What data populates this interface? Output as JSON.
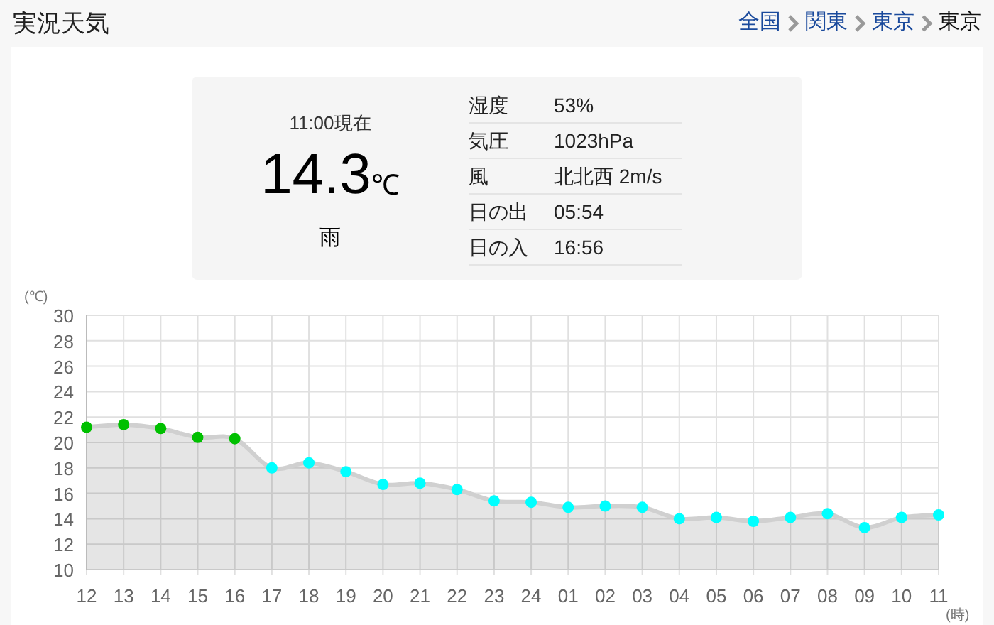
{
  "header": {
    "title": "実況天気"
  },
  "breadcrumb": [
    {
      "label": "全国",
      "link": true
    },
    {
      "label": "関東",
      "link": true
    },
    {
      "label": "東京",
      "link": true
    },
    {
      "label": "東京",
      "link": false
    }
  ],
  "current": {
    "time": "11:00現在",
    "temperature": "14.3",
    "unit": "℃",
    "weather": "雨"
  },
  "details": [
    {
      "label": "湿度",
      "value": "53%"
    },
    {
      "label": "気圧",
      "value": "1023hPa"
    },
    {
      "label": "風",
      "value": "北北西 2m/s"
    },
    {
      "label": "日の出",
      "value": "05:54"
    },
    {
      "label": "日の入",
      "value": "16:56"
    }
  ],
  "chart_data": {
    "type": "area",
    "xlabel": "(時)",
    "ylabel": "(℃)",
    "categories": [
      "12",
      "13",
      "14",
      "15",
      "16",
      "17",
      "18",
      "19",
      "20",
      "21",
      "22",
      "23",
      "24",
      "01",
      "02",
      "03",
      "04",
      "05",
      "06",
      "07",
      "08",
      "09",
      "10",
      "11"
    ],
    "series": [
      {
        "color": "#d0d0d0",
        "values": [
          21.2,
          21.4,
          21.1,
          20.4,
          20.3,
          18.0,
          18.4,
          17.7,
          16.7,
          16.8,
          16.3,
          15.4,
          15.3,
          14.9,
          15.0,
          14.9,
          14.0,
          14.1,
          13.8,
          14.1,
          14.4,
          13.3,
          14.1,
          14.3
        ]
      }
    ],
    "grid": true,
    "ylim": [
      10,
      30
    ],
    "yticks": [
      10,
      12,
      14,
      16,
      18,
      20,
      22,
      24,
      26,
      28,
      30
    ]
  },
  "chart_markers": [
    {
      "color": "#00c000"
    },
    {
      "color": "#00c000"
    },
    {
      "color": "#00c000"
    },
    {
      "color": "#00c000"
    },
    {
      "color": "#00c000"
    },
    {
      "color": "#00ffff"
    },
    {
      "color": "#00ffff"
    },
    {
      "color": "#00ffff"
    },
    {
      "color": "#00ffff"
    },
    {
      "color": "#00ffff"
    },
    {
      "color": "#00ffff"
    },
    {
      "color": "#00ffff"
    },
    {
      "color": "#00ffff"
    },
    {
      "color": "#00ffff"
    },
    {
      "color": "#00ffff"
    },
    {
      "color": "#00ffff"
    },
    {
      "color": "#00ffff"
    },
    {
      "color": "#00ffff"
    },
    {
      "color": "#00ffff"
    },
    {
      "color": "#00ffff"
    },
    {
      "color": "#00ffff"
    },
    {
      "color": "#00ffff"
    },
    {
      "color": "#00ffff"
    },
    {
      "color": "#00ffff"
    }
  ]
}
